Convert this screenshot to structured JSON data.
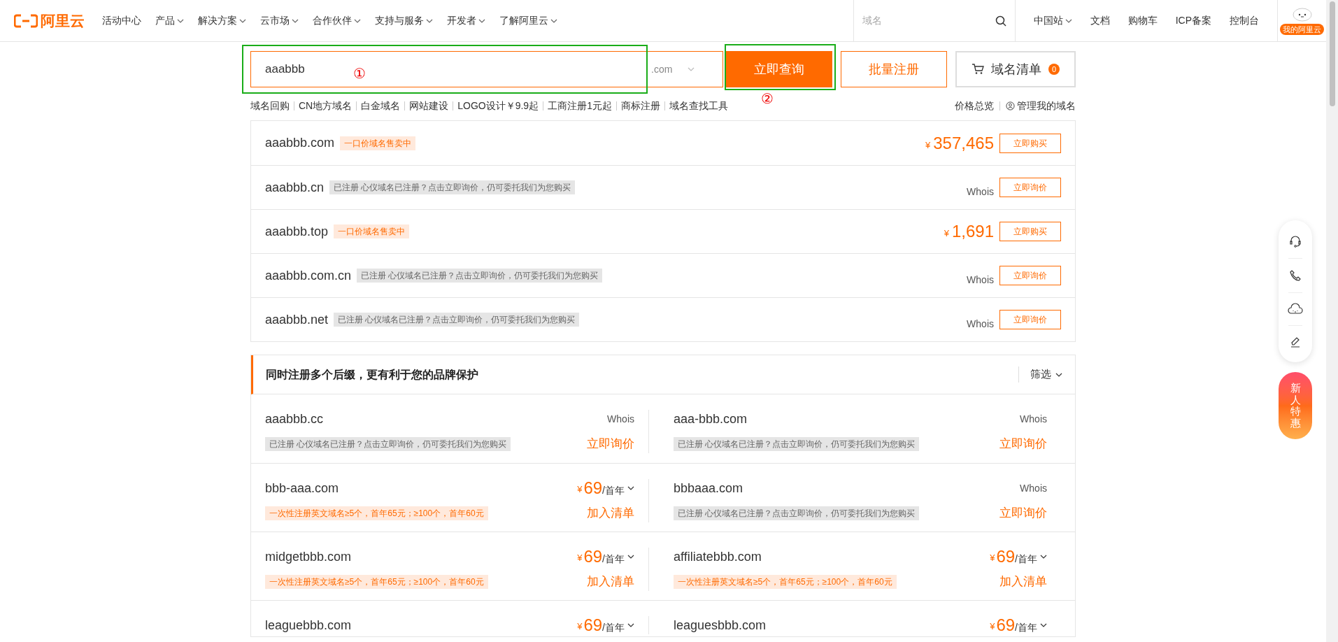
{
  "header": {
    "logo_text": "阿里云",
    "nav": [
      {
        "label": "活动中心",
        "caret": false
      },
      {
        "label": "产品",
        "caret": true
      },
      {
        "label": "解决方案",
        "caret": true
      },
      {
        "label": "云市场",
        "caret": true
      },
      {
        "label": "合作伙伴",
        "caret": true
      },
      {
        "label": "支持与服务",
        "caret": true
      },
      {
        "label": "开发者",
        "caret": true
      },
      {
        "label": "了解阿里云",
        "caret": true
      }
    ],
    "search_placeholder": "域名",
    "links": [
      {
        "label": "中国站",
        "caret": true
      },
      {
        "label": "文档",
        "caret": false
      },
      {
        "label": "购物车",
        "caret": false
      },
      {
        "label": "ICP备案",
        "caret": false
      },
      {
        "label": "控制台",
        "caret": false
      }
    ],
    "avatar_label": "我的阿里云"
  },
  "search": {
    "value": "aaabbb",
    "suffix": ".com",
    "query_button": "立即查询",
    "bulk_button": "批量注册",
    "cart_label": "域名清单",
    "cart_count": "0",
    "marks": [
      "①",
      "②"
    ]
  },
  "quick_links": [
    "域名回购",
    "CN地方域名",
    "白金域名",
    "网站建设",
    "LOGO设计￥9.9起",
    "工商注册1元起",
    "商标注册",
    "域名查找工具"
  ],
  "side_links": [
    {
      "label": "价格总览",
      "icon": false
    },
    {
      "label": "管理我的域名",
      "icon": true
    }
  ],
  "results": [
    {
      "domain": "aaabbb.com",
      "kind": "sale",
      "tag": "一口价域名售卖中",
      "currency": "¥",
      "price": "357,465",
      "action": "立即购买"
    },
    {
      "domain": "aaabbb.cn",
      "kind": "registered",
      "tag": "已注册 心仪域名已注册？点击立即询价，仍可委托我们为您购买",
      "whois": "Whois",
      "action": "立即询价"
    },
    {
      "domain": "aaabbb.top",
      "kind": "sale",
      "tag": "一口价域名售卖中",
      "currency": "¥",
      "price": "1,691",
      "action": "立即购买"
    },
    {
      "domain": "aaabbb.com.cn",
      "kind": "registered",
      "tag": "已注册 心仪域名已注册？点击立即询价，仍可委托我们为您购买",
      "whois": "Whois",
      "action": "立即询价"
    },
    {
      "domain": "aaabbb.net",
      "kind": "registered",
      "tag": "已注册 心仪域名已注册？点击立即询价，仍可委托我们为您购买",
      "whois": "Whois",
      "action": "立即询价"
    }
  ],
  "suggestions": {
    "title": "同时注册多个后缀，更有利于您的品牌保护",
    "filter": "筛选",
    "items": [
      {
        "domain": "aaabbb.cc",
        "kind": "registered",
        "whois": "Whois",
        "tag": "已注册 心仪域名已注册？点击立即询价，仍可委托我们为您购买",
        "action": "立即询价"
      },
      {
        "domain": "aaa-bbb.com",
        "kind": "registered",
        "whois": "Whois",
        "tag": "已注册 心仪域名已注册？点击立即询价，仍可委托我们为您购买",
        "action": "立即询价"
      },
      {
        "domain": "bbb-aaa.com",
        "kind": "available",
        "currency": "¥",
        "price": "69",
        "unit": "/首年",
        "tag": "一次性注册英文域名≥5个，首年65元；≥100个，首年60元",
        "action": "加入清单"
      },
      {
        "domain": "bbbaaa.com",
        "kind": "registered",
        "whois": "Whois",
        "tag": "已注册 心仪域名已注册？点击立即询价，仍可委托我们为您购买",
        "action": "立即询价"
      },
      {
        "domain": "midgetbbb.com",
        "kind": "available",
        "currency": "¥",
        "price": "69",
        "unit": "/首年",
        "tag": "一次性注册英文域名≥5个，首年65元；≥100个，首年60元",
        "action": "加入清单"
      },
      {
        "domain": "affiliatebbb.com",
        "kind": "available",
        "currency": "¥",
        "price": "69",
        "unit": "/首年",
        "tag": "一次性注册英文域名≥5个，首年65元；≥100个，首年60元",
        "action": "加入清单"
      },
      {
        "domain": "leaguebbb.com",
        "kind": "available_cut",
        "currency": "¥",
        "price": "69",
        "unit": "/首年"
      },
      {
        "domain": "leaguesbbb.com",
        "kind": "available_cut",
        "currency": "¥",
        "price": "69",
        "unit": "/首年"
      }
    ]
  },
  "promo": "新人特惠"
}
